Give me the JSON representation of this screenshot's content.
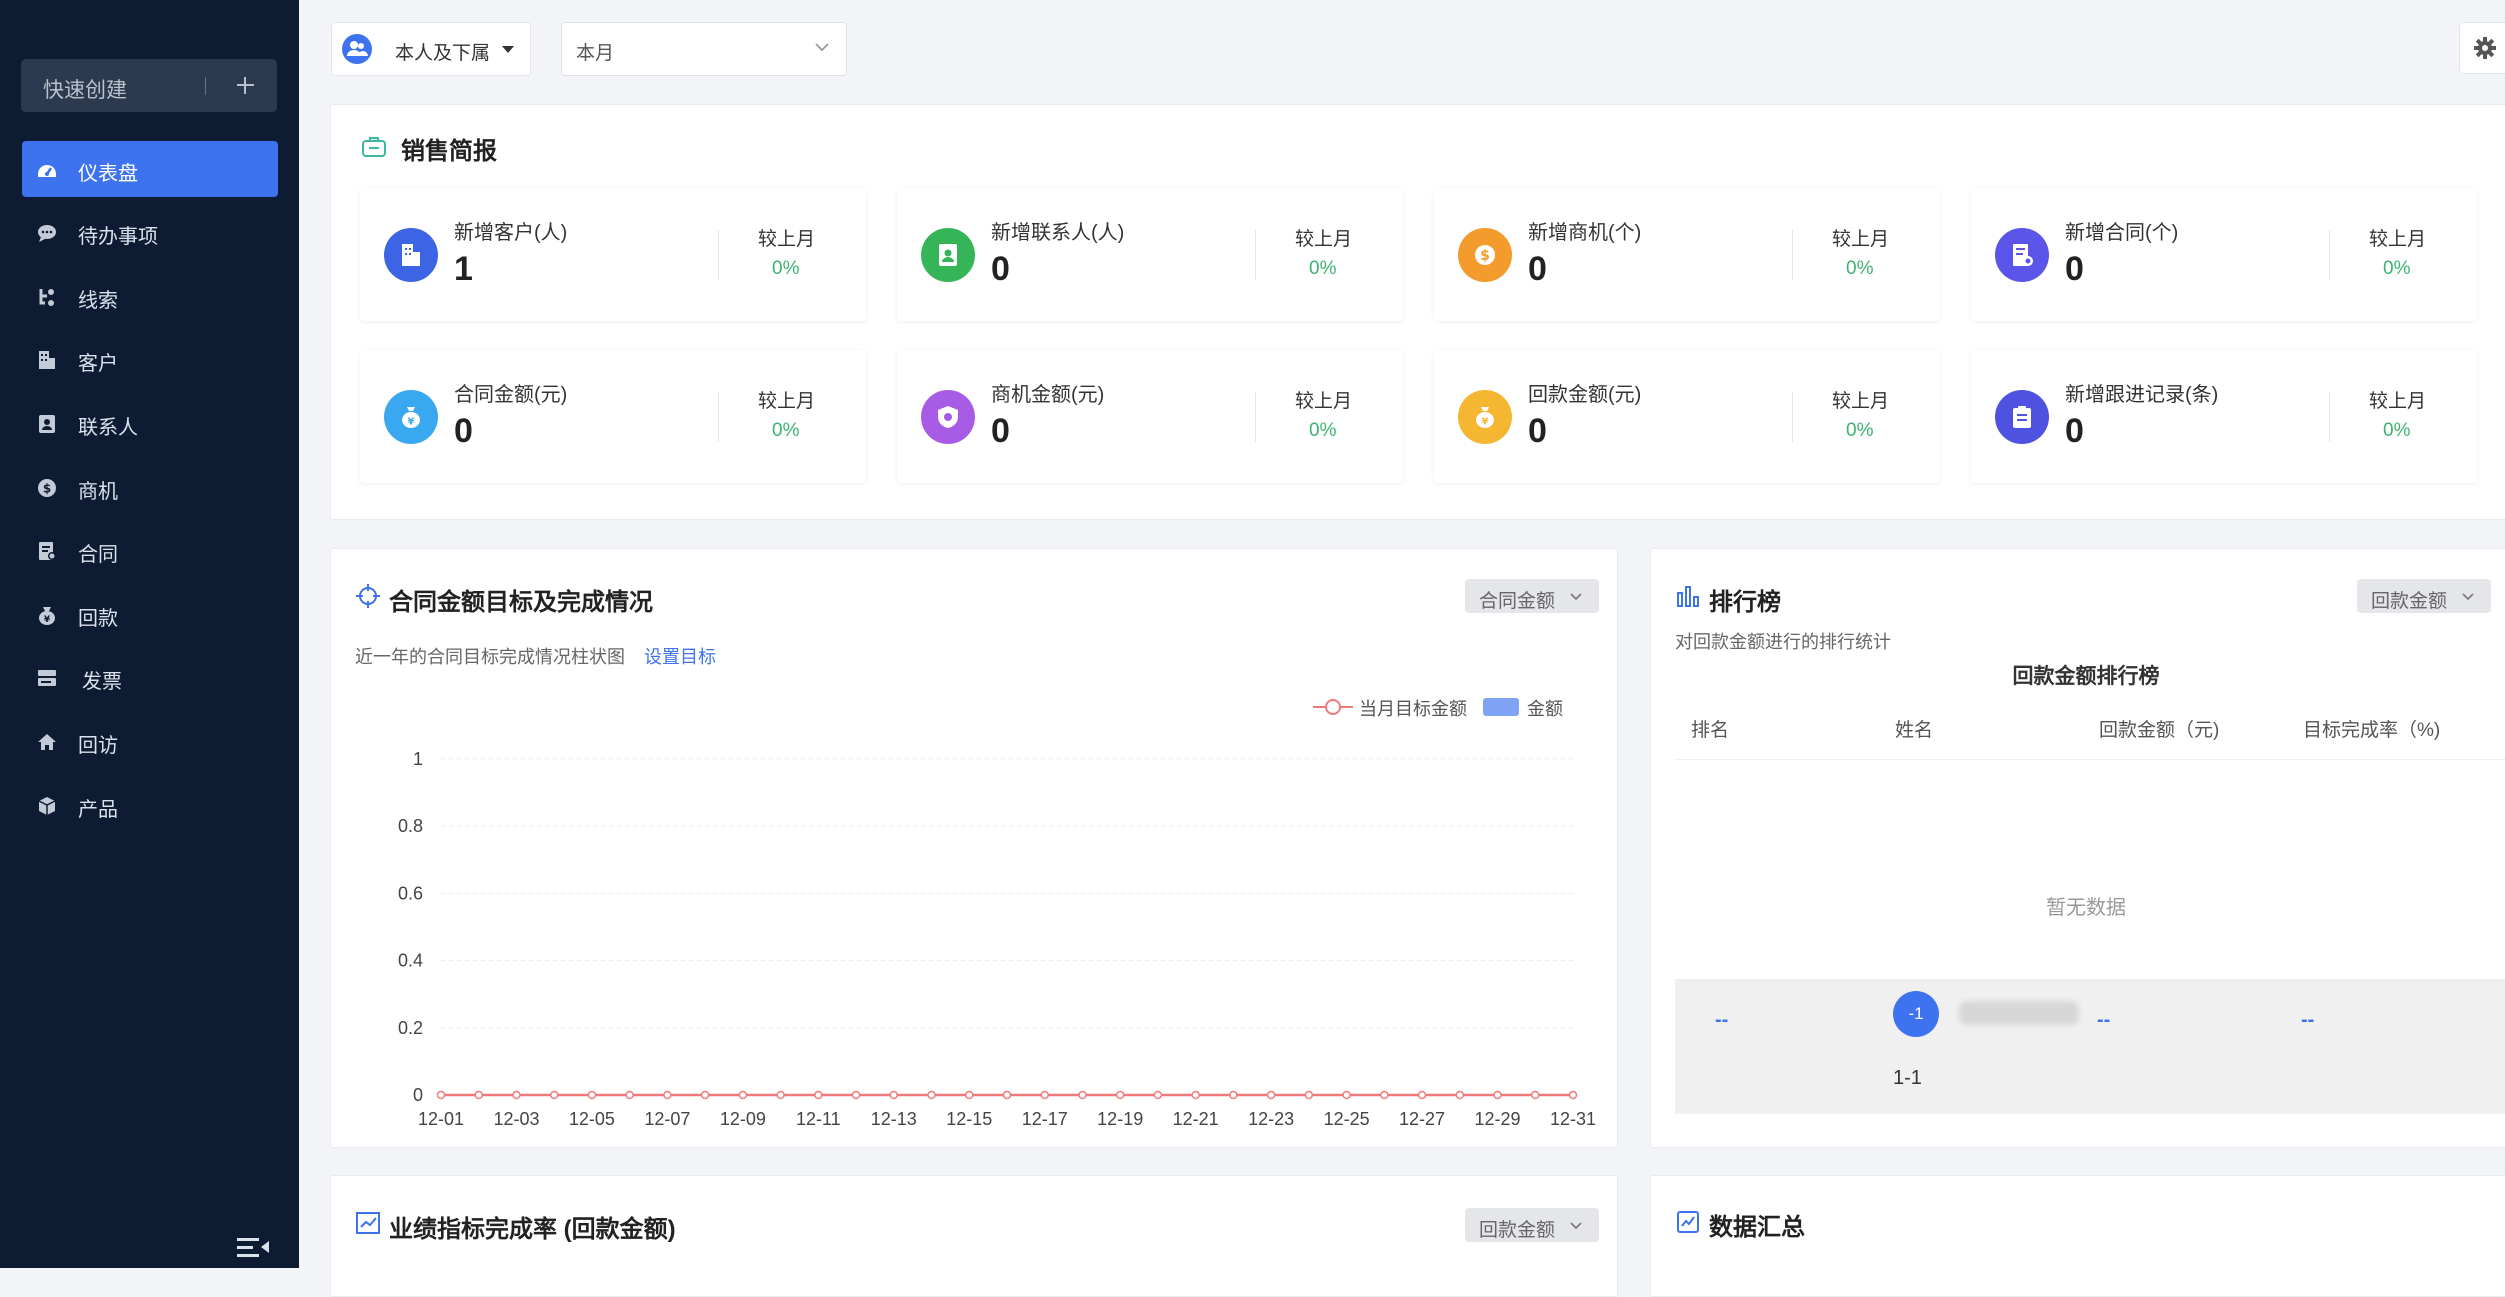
{
  "sidebar": {
    "quick_create": "快速创建",
    "items": [
      {
        "label": "仪表盘",
        "icon": "dashboard-icon",
        "active": true
      },
      {
        "label": "待办事项",
        "icon": "chat-bubble-icon"
      },
      {
        "label": "线索",
        "icon": "clue-icon"
      },
      {
        "label": "客户",
        "icon": "building-icon"
      },
      {
        "label": "联系人",
        "icon": "contact-card-icon"
      },
      {
        "label": "商机",
        "icon": "dollar-coin-icon"
      },
      {
        "label": "合同",
        "icon": "contract-icon"
      },
      {
        "label": "回款",
        "icon": "money-bag-icon"
      },
      {
        "label": "发票",
        "icon": "invoice-icon"
      },
      {
        "label": "回访",
        "icon": "home-icon"
      },
      {
        "label": "产品",
        "icon": "box-icon"
      }
    ]
  },
  "topbar": {
    "scope_label": "本人及下属",
    "period_value": "本月"
  },
  "sales_brief": {
    "title": "销售简报",
    "cards": [
      {
        "label": "新增客户(人)",
        "value": "1",
        "compare_label": "较上月",
        "change": "0%",
        "color": "#3e64e6",
        "icon": "building-icon"
      },
      {
        "label": "新增联系人(人)",
        "value": "0",
        "compare_label": "较上月",
        "change": "0%",
        "color": "#35b557",
        "icon": "contact-card-icon"
      },
      {
        "label": "新增商机(个)",
        "value": "0",
        "compare_label": "较上月",
        "change": "0%",
        "color": "#f39b2c",
        "icon": "dollar-coin-icon"
      },
      {
        "label": "新增合同(个)",
        "value": "0",
        "compare_label": "较上月",
        "change": "0%",
        "color": "#5a55e8",
        "icon": "contract-icon"
      },
      {
        "label": "合同金额(元)",
        "value": "0",
        "compare_label": "较上月",
        "change": "0%",
        "color": "#3aa8f0",
        "icon": "money-bag-icon"
      },
      {
        "label": "商机金额(元)",
        "value": "0",
        "compare_label": "较上月",
        "change": "0%",
        "color": "#a85ce6",
        "icon": "shield-icon"
      },
      {
        "label": "回款金额(元)",
        "value": "0",
        "compare_label": "较上月",
        "change": "0%",
        "color": "#f5b731",
        "icon": "money-bag-icon"
      },
      {
        "label": "新增跟进记录(条)",
        "value": "0",
        "compare_label": "较上月",
        "change": "0%",
        "color": "#4f52e0",
        "icon": "clipboard-icon"
      }
    ]
  },
  "target_panel": {
    "title": "合同金额目标及完成情况",
    "dropdown": "合同金额",
    "subtitle": "近一年的合同目标完成情况柱状图",
    "set_target_link": "设置目标",
    "legend_target": "当月目标金额",
    "legend_amount": "金额"
  },
  "chart_data": {
    "type": "line",
    "x": [
      "12-01",
      "12-02",
      "12-03",
      "12-04",
      "12-05",
      "12-06",
      "12-07",
      "12-08",
      "12-09",
      "12-10",
      "12-11",
      "12-12",
      "12-13",
      "12-14",
      "12-15",
      "12-16",
      "12-17",
      "12-18",
      "12-19",
      "12-20",
      "12-21",
      "12-22",
      "12-23",
      "12-24",
      "12-25",
      "12-26",
      "12-27",
      "12-28",
      "12-29",
      "12-30",
      "12-31"
    ],
    "x_tick_labels": [
      "12-01",
      "12-03",
      "12-05",
      "12-07",
      "12-09",
      "12-11",
      "12-13",
      "12-15",
      "12-17",
      "12-19",
      "12-21",
      "12-23",
      "12-25",
      "12-27",
      "12-29",
      "12-31"
    ],
    "series": [
      {
        "name": "当月目标金额",
        "type": "line",
        "color": "#f07a7a",
        "values": [
          0,
          0,
          0,
          0,
          0,
          0,
          0,
          0,
          0,
          0,
          0,
          0,
          0,
          0,
          0,
          0,
          0,
          0,
          0,
          0,
          0,
          0,
          0,
          0,
          0,
          0,
          0,
          0,
          0,
          0,
          0
        ]
      },
      {
        "name": "金额",
        "type": "bar",
        "color": "#7fa4f5",
        "values": [
          0,
          0,
          0,
          0,
          0,
          0,
          0,
          0,
          0,
          0,
          0,
          0,
          0,
          0,
          0,
          0,
          0,
          0,
          0,
          0,
          0,
          0,
          0,
          0,
          0,
          0,
          0,
          0,
          0,
          0,
          0
        ]
      }
    ],
    "ylim": [
      0,
      1
    ],
    "y_ticks": [
      "0",
      "0.2",
      "0.4",
      "0.6",
      "0.8",
      "1"
    ],
    "grid": true,
    "legend": "top-right"
  },
  "ranking_panel": {
    "title": "排行榜",
    "dropdown": "回款金额",
    "subtitle": "对回款金额进行的排行统计",
    "table_title": "回款金额排行榜",
    "columns": [
      "排名",
      "姓名",
      "回款金额（元)",
      "目标完成率（%)"
    ],
    "empty_text": "暂无数据",
    "my_row": {
      "rank": "--",
      "badge": "-1",
      "amount": "--",
      "rate": "--",
      "dept": "1-1"
    }
  },
  "perf_panel": {
    "title": "业绩指标完成率 (回款金额)",
    "dropdown": "回款金额"
  },
  "summary_panel": {
    "title": "数据汇总"
  }
}
